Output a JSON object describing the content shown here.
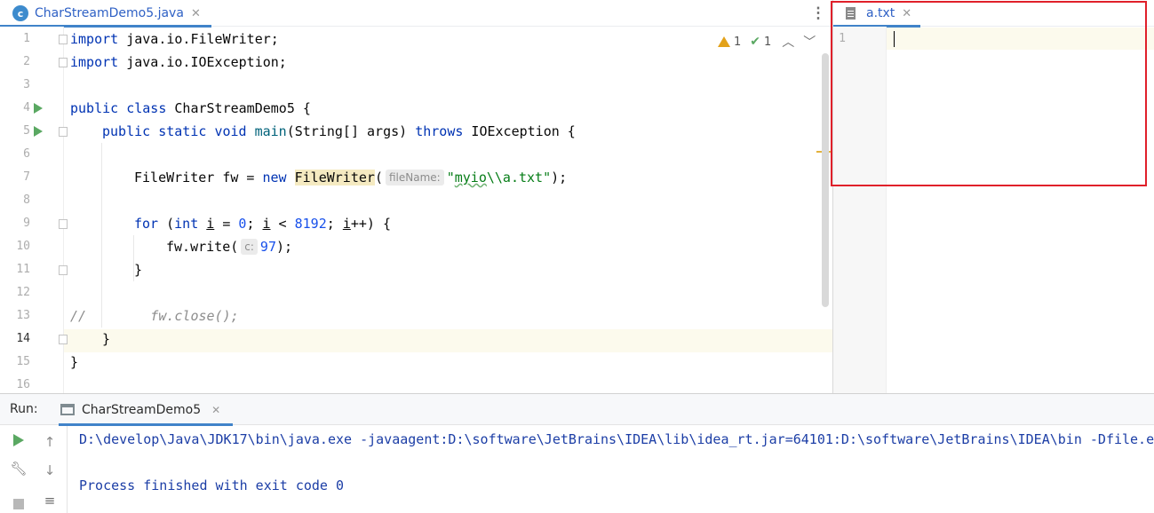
{
  "left_editor": {
    "tab_label": "CharStreamDemo5.java",
    "tab_icon": "java-class-icon",
    "inspections": {
      "warnings": "1",
      "weak_warnings": "1"
    },
    "line_numbers": [
      "1",
      "2",
      "3",
      "4",
      "5",
      "6",
      "7",
      "8",
      "9",
      "10",
      "11",
      "12",
      "13",
      "14",
      "15",
      "16"
    ],
    "code": {
      "l1_kw": "import",
      "l1_rest": " java.io.FileWriter;",
      "l2_kw": "import",
      "l2_rest": " java.io.IOException;",
      "l4_kw1": "public",
      "l4_kw2": "class",
      "l4_rest": " CharStreamDemo5 {",
      "l5_kw1": "public",
      "l5_kw2": "static",
      "l5_kw3": "void",
      "l5_name": " main",
      "l5_mid": "(String[] args) ",
      "l5_kw4": "throws",
      "l5_rest": " IOException {",
      "l7_a": "FileWriter fw = ",
      "l7_kw": "new",
      "l7_cls": "FileWriter",
      "l7_paren": "(",
      "l7_hint": "fileName:",
      "l7_str_q": "\"",
      "l7_str_a": "myio",
      "l7_str_b": "\\\\a.txt\"",
      "l7_end": ");",
      "l9_kw1": "for",
      "l9_p": " (",
      "l9_kw2": "int",
      "l9_sp": " ",
      "l9_i1": "i",
      "l9_eq": " = ",
      "l9_zero": "0",
      "l9_semi": "; ",
      "l9_i2": "i",
      "l9_lt": " < ",
      "l9_num": "8192",
      "l9_semi2": "; ",
      "l9_i3": "i",
      "l9_end": "++) {",
      "l10_a": "fw.write(",
      "l10_hint": "c:",
      "l10_num": "97",
      "l10_end": ");",
      "l11": "}",
      "l13": "//        fw.close();",
      "l14": "}",
      "l15": "}"
    }
  },
  "right_editor": {
    "tab_label": "a.txt",
    "tab_icon": "text-file-icon",
    "line_numbers": [
      "1"
    ],
    "content": ""
  },
  "run_panel": {
    "label": "Run:",
    "tab_label": "CharStreamDemo5",
    "console_lines": [
      "D:\\develop\\Java\\JDK17\\bin\\java.exe -javaagent:D:\\software\\JetBrains\\IDEA\\lib\\idea_rt.jar=64101:D:\\software\\JetBrains\\IDEA\\bin -Dfile.en",
      "",
      "Process finished with exit code 0"
    ]
  },
  "colors": {
    "keyword": "#0033b3",
    "string": "#067d17",
    "number": "#1750eb",
    "comment": "#8c8c8c",
    "console_text": "#1c3ea6",
    "highlight_box": "#e0202a"
  }
}
